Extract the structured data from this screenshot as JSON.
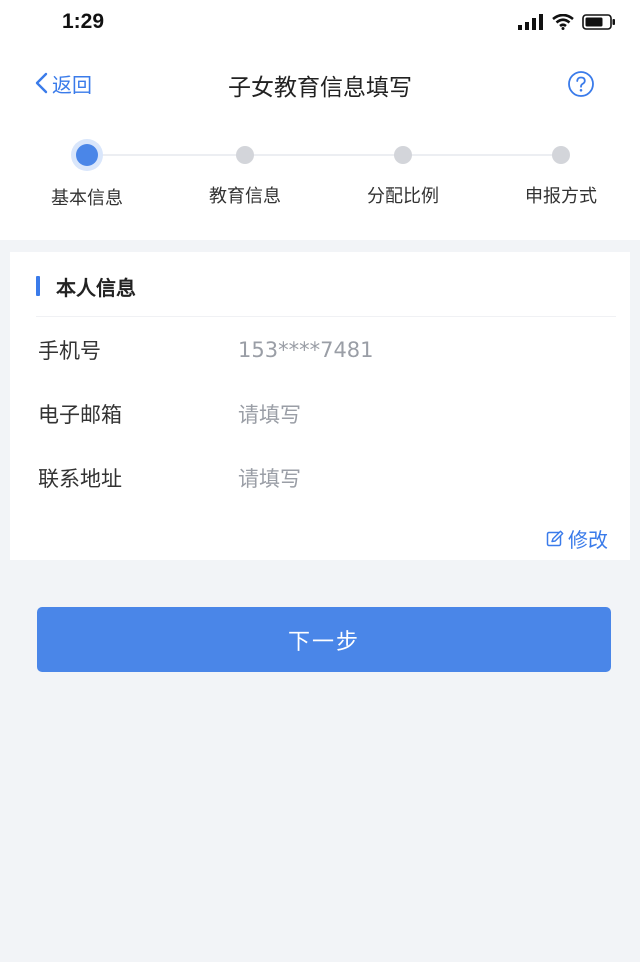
{
  "status_bar": {
    "time": "1:29"
  },
  "nav": {
    "back_label": "返回",
    "title": "子女教育信息填写"
  },
  "steps": [
    {
      "label": "基本信息",
      "active": true
    },
    {
      "label": "教育信息",
      "active": false
    },
    {
      "label": "分配比例",
      "active": false
    },
    {
      "label": "申报方式",
      "active": false
    }
  ],
  "section": {
    "title": "本人信息",
    "fields": [
      {
        "label": "手机号",
        "value": "153****7481"
      },
      {
        "label": "电子邮箱",
        "value": "请填写"
      },
      {
        "label": "联系地址",
        "value": "请填写"
      }
    ],
    "edit_label": "修改"
  },
  "next_button": "下一步",
  "colors": {
    "accent": "#4a86e8",
    "link": "#3a7bea",
    "inactive_dot": "#d3d5da",
    "page_bg": "#f2f4f7"
  }
}
